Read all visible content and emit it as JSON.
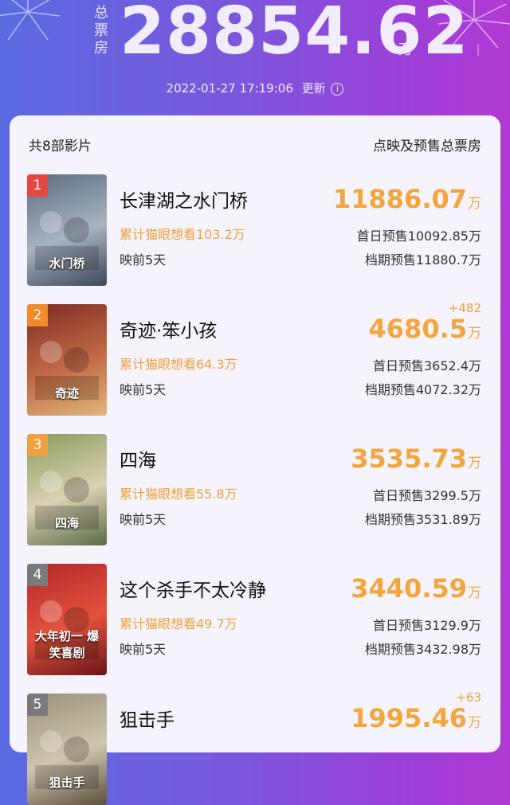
{
  "header": {
    "total_label": "总票房",
    "total_value": "28854.62",
    "total_unit": "万",
    "timestamp": "2022-01-27  17:19:06",
    "update_label": "更新",
    "info_glyph": "i"
  },
  "list": {
    "count_label": "共8部影片",
    "column_label": "点映及预售总票房"
  },
  "movies": [
    {
      "rank": "1",
      "title": "长津湖之水门桥",
      "want": "累计猫眼想看103.2万",
      "days": "映前5天",
      "box": "11886.07",
      "unit": "万",
      "first": "首日预售10092.85万",
      "period": "档期预售11880.7万",
      "delta": "",
      "rank_color": "#e84545",
      "poster_colors": [
        "#5a6b82",
        "#a8b3bf",
        "#3b4658"
      ],
      "poster_text": "水门桥"
    },
    {
      "rank": "2",
      "title": "奇迹·笨小孩",
      "want": "累计猫眼想看64.3万",
      "days": "映前5天",
      "box": "4680.5",
      "unit": "万",
      "first": "首日预售3652.4万",
      "period": "档期预售4072.32万",
      "delta": "+482",
      "rank_color": "#f08a2a",
      "poster_colors": [
        "#7d2b22",
        "#c26a45",
        "#e0b67a"
      ],
      "poster_text": "奇迹"
    },
    {
      "rank": "3",
      "title": "四海",
      "want": "累计猫眼想看55.8万",
      "days": "映前5天",
      "box": "3535.73",
      "unit": "万",
      "first": "首日预售3299.5万",
      "period": "档期预售3531.89万",
      "delta": "",
      "rank_color": "#f0a13d",
      "poster_colors": [
        "#8a9a5a",
        "#d9d2b4",
        "#5b6a44"
      ],
      "poster_text": "四海"
    },
    {
      "rank": "4",
      "title": "这个杀手不太冷静",
      "want": "累计猫眼想看49.7万",
      "days": "映前5天",
      "box": "3440.59",
      "unit": "万",
      "first": "首日预售3129.9万",
      "period": "档期预售3432.98万",
      "delta": "",
      "rank_color": "#7a7a7a",
      "poster_colors": [
        "#b3262a",
        "#e3533c",
        "#6b1416"
      ],
      "poster_text": "大年初一 爆笑喜剧"
    },
    {
      "rank": "5",
      "title": "狙击手",
      "want": "",
      "days": "",
      "box": "1995.46",
      "unit": "万",
      "first": "",
      "period": "",
      "delta": "+63",
      "rank_color": "#7a7a7a",
      "poster_colors": [
        "#9b8f79",
        "#cfc6b0",
        "#5c4f3c"
      ],
      "poster_text": "狙击手"
    }
  ],
  "colors": {
    "accent": "#f5a53b",
    "bg_start": "#5a6be0",
    "bg_end": "#b13ad3",
    "card": "#f5f3fb"
  }
}
